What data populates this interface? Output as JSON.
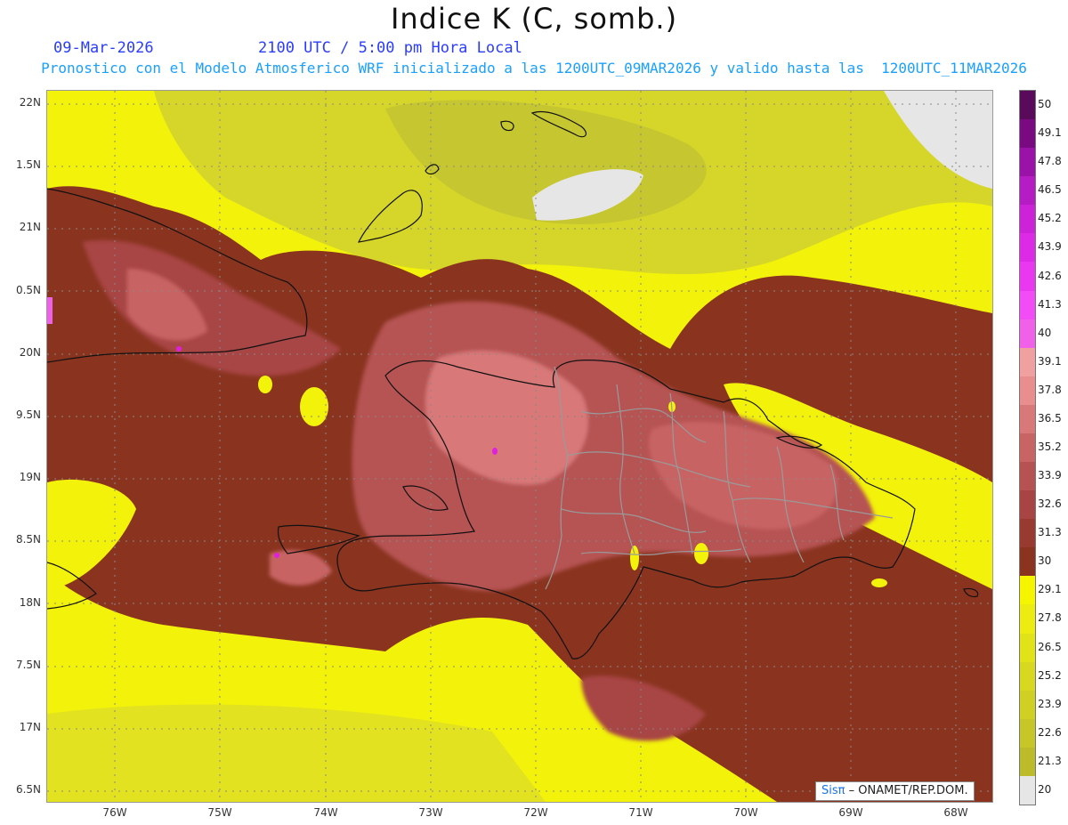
{
  "header": {
    "title": "Indice K (C, somb.)",
    "date": "09-Mar-2026",
    "valid_time": "2100 UTC / 5:00 pm Hora Local",
    "model_line": "Pronostico con el Modelo Atmosferico WRF inicializado a las 1200UTC_09MAR2026 y valido hasta las  1200UTC_11MAR2026"
  },
  "axes": {
    "lat_labels": [
      "22N",
      "1.5N",
      "21N",
      "0.5N",
      "20N",
      "9.5N",
      "19N",
      "8.5N",
      "18N",
      "7.5N",
      "17N",
      "6.5N"
    ],
    "lon_labels": [
      "76W",
      "75W",
      "74W",
      "73W",
      "72W",
      "71W",
      "70W",
      "69W",
      "68W"
    ]
  },
  "colorbar": {
    "labels": [
      "50",
      "49.1",
      "47.8",
      "46.5",
      "45.2",
      "43.9",
      "42.6",
      "41.3",
      "40",
      "39.1",
      "37.8",
      "36.5",
      "35.2",
      "33.9",
      "32.6",
      "31.3",
      "30",
      "29.1",
      "27.8",
      "26.5",
      "25.2",
      "23.9",
      "22.6",
      "21.3",
      "20"
    ],
    "colors": [
      "#5a0a5a",
      "#7a0a82",
      "#9a12a8",
      "#b61cc4",
      "#cc22d8",
      "#dd2ae6",
      "#ea38f0",
      "#f24cf6",
      "#f060e8",
      "#f0a0a0",
      "#e88e8e",
      "#d87878",
      "#c86464",
      "#b65252",
      "#a84444",
      "#983a30",
      "#8a3420",
      "#f5f500",
      "#ecec10",
      "#e2e218",
      "#d8d820",
      "#cfcf24",
      "#c6c628",
      "#bcbc2a",
      "#e6e6e6"
    ]
  },
  "credit": {
    "brand": "Sisπ",
    "text": " – ONAMET/REP.DOM."
  }
}
